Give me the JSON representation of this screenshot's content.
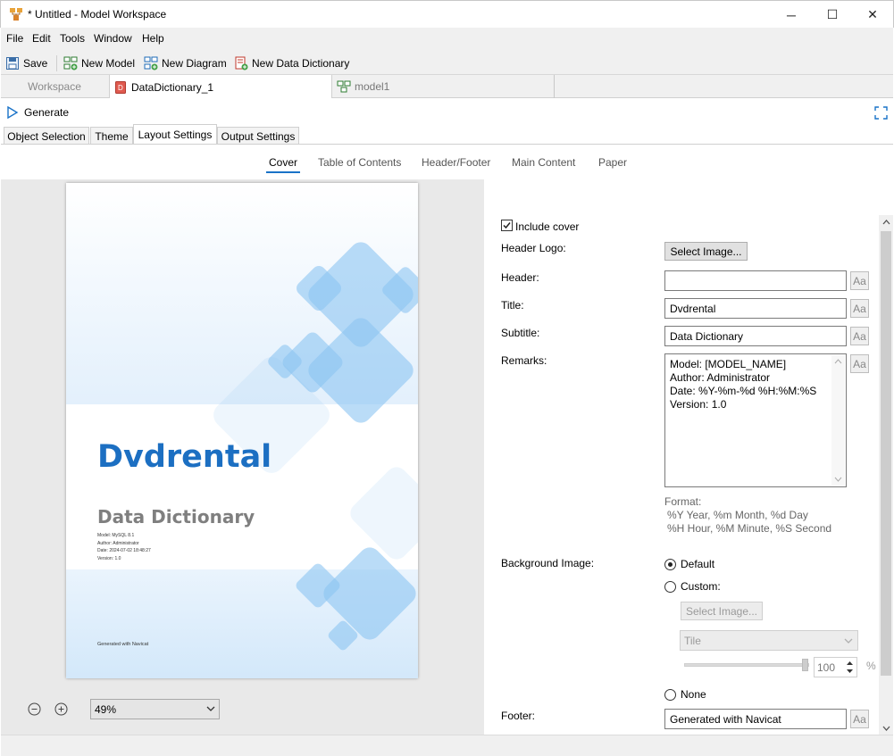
{
  "window": {
    "title": "* Untitled - Model Workspace",
    "minimize": "─",
    "maximize": "☐",
    "close": "✕"
  },
  "menu": [
    "File",
    "Edit",
    "Tools",
    "Window",
    "Help"
  ],
  "toolbar": {
    "save": "Save",
    "new_model": "New Model",
    "new_diagram": "New Diagram",
    "new_data_dictionary": "New Data Dictionary"
  },
  "doc_tabs": [
    "Workspace",
    "DataDictionary_1",
    "model1"
  ],
  "generate": "Generate",
  "sub_tabs": [
    "Object Selection",
    "Theme",
    "Layout Settings",
    "Output Settings"
  ],
  "section_tabs": [
    "Cover",
    "Table of Contents",
    "Header/Footer",
    "Main Content",
    "Paper"
  ],
  "preview": {
    "title": "Dvdrental",
    "subtitle": "Data Dictionary",
    "meta": [
      "Model: MySQL 8.1",
      "Author: Administrator",
      "Date: 2024-07-02 18:48:27",
      "Version: 1.0"
    ],
    "footer": "Generated with Navicat",
    "zoom": "49%"
  },
  "settings": {
    "include_cover": "Include cover",
    "header_logo_label": "Header Logo:",
    "select_image": "Select Image...",
    "header_label": "Header:",
    "header_value": "",
    "title_label": "Title:",
    "title_value": "Dvdrental",
    "subtitle_label": "Subtitle:",
    "subtitle_value": "Data Dictionary",
    "remarks_label": "Remarks:",
    "remarks_lines": [
      "Model: [MODEL_NAME]",
      "Author: Administrator",
      "Date: %Y-%m-%d %H:%M:%S",
      "Version: 1.0"
    ],
    "format_label": "Format:",
    "format_line1": "%Y Year, %m Month, %d Day",
    "format_line2": "%H Hour, %M Minute, %S Second",
    "background_image_label": "Background Image:",
    "bg_default": "Default",
    "bg_custom": "Custom:",
    "bg_select_image": "Select Image...",
    "bg_mode": "Tile",
    "opacity_value": "100",
    "percent": "%",
    "bg_none": "None",
    "footer_label": "Footer:",
    "footer_value": "Generated with Navicat",
    "aa": "Aa"
  },
  "colors": {
    "accent_blue": "#1a73c8",
    "cover_title": "#1c6fc2",
    "cover_subtitle": "#7f7f7f",
    "shape_blue": "#8cc4f2"
  }
}
